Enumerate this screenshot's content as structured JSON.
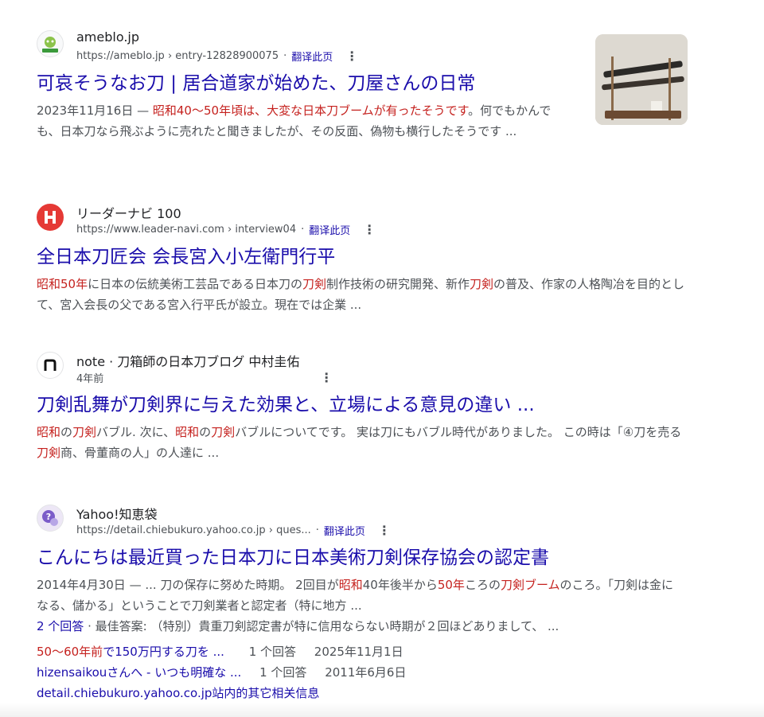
{
  "colors": {
    "link": "#1a0dab",
    "highlight": "#c5221f",
    "text": "#4d5156"
  },
  "results": [
    {
      "favicon": "ameba-icon",
      "site": "ameblo.jp",
      "url": "https://ameblo.jp › entry-12828900075",
      "translate": "翻译此页",
      "title": "可哀そうなお刀 | 居合道家が始めた、刀屋さんの日常",
      "snippet": {
        "date": "2023年11月16日 — ",
        "highlight": "昭和40〜50年頃は、大変な日本刀ブームが有ったそうです",
        "rest": "。何でもかんでも、日本刀なら飛ぶように売れたと聞きましたが、その反面、偽物も横行したそうです ..."
      }
    },
    {
      "favicon": "leader-navi-icon",
      "site": "リーダーナビ 100",
      "url": "https://www.leader-navi.com › interview04",
      "translate": "翻译此页",
      "title": "全日本刀匠会 会長宮入小左衛門行平",
      "snippet": {
        "p1": "昭和50年",
        "p2": "に日本の伝統美術工芸品である日本刀の",
        "p3": "刀剣",
        "p4": "制作技術の研究開発、新作",
        "p5": "刀剣",
        "p6": "の普及、作家の人格陶冶を目的として、宮入会長の父である宮入行平氏が設立。現在では企業 ..."
      }
    },
    {
      "favicon": "note-icon",
      "site": "note · 刀箱師の日本刀ブログ 中村圭佑",
      "age": "4年前",
      "title": "刀剣乱舞が刀剣界に与えた効果と、立場による意見の違い ...",
      "snippet": {
        "p1": "昭和",
        "p2": "の",
        "p3": "刀剣",
        "p4": "バブル. 次に、",
        "p5": "昭和",
        "p6": "の",
        "p7": "刀剣",
        "p8": "バブルについてです。 実は刀にもバブル時代がありました。 この時は「④刀を売る",
        "p9": "刀剣",
        "p10": "商、骨董商の人」の人達に ..."
      }
    },
    {
      "favicon": "yahoo-chiebukuro-icon",
      "site": "Yahoo!知恵袋",
      "url": "https://detail.chiebukuro.yahoo.co.jp › ques...",
      "translate": "翻译此页",
      "title": "こんにちは最近買った日本刀に日本美術刀剣保存協会の認定書",
      "snippet": {
        "p1": "2014年4月30日 — ... 刀の保存に努めた時期。 2回目が",
        "p2": "昭和",
        "p3": "40年後半から",
        "p4": "50年",
        "p5": "ころの",
        "p6": "刀剣ブーム",
        "p7": "のころ。「刀剣は金になる、儲かる」ということで刀剣業者と認定者（特に地方 ..."
      },
      "answers": {
        "count": "2 个回答",
        "best": " · 最佳答案: （特別）貴重刀剣認定書が特に信用ならない時期が２回ほどありまして、 ..."
      },
      "related": [
        {
          "hl": "50〜60年前",
          "text": "で150万円する刀を ...",
          "answers": "1 个回答",
          "date": "2025年11月1日"
        },
        {
          "hl": "",
          "text": "hizensaikouさんへ - いつも明確な ...",
          "answers": "1 个回答",
          "date": "2011年6月6日"
        }
      ],
      "more_link": "detail.chiebukuro.yahoo.co.jp站内的其它相关信息"
    }
  ]
}
